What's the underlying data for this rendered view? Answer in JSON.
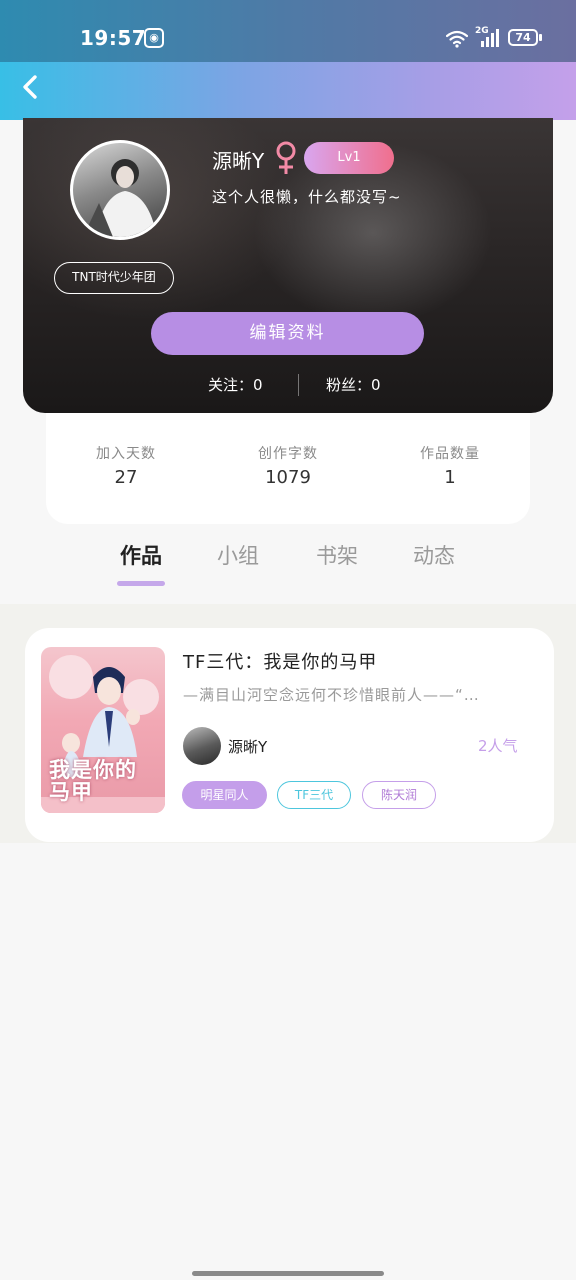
{
  "status_bar": {
    "time": "19:57",
    "network_label": "2G",
    "battery": "74",
    "icons": [
      "app-notification-icon",
      "wifi-icon",
      "signal-icon",
      "battery-icon"
    ]
  },
  "header": {
    "back_icon": "chevron-left-icon"
  },
  "profile": {
    "nickname": "源晰Y",
    "gender_icon": "female-icon",
    "level": "Lv1",
    "bio": "这个人很懒，什么都没写~",
    "group_tag": "TNT时代少年团",
    "edit_button": "编辑资料",
    "follow": "关注：0",
    "fans": "粉丝：0"
  },
  "stats": [
    {
      "label": "加入天数",
      "value": "27"
    },
    {
      "label": "创作字数",
      "value": "1079"
    },
    {
      "label": "作品数量",
      "value": "1"
    }
  ],
  "tabs": [
    {
      "label": "作品",
      "active": true
    },
    {
      "label": "小组",
      "active": false
    },
    {
      "label": "书架",
      "active": false
    },
    {
      "label": "动态",
      "active": false
    }
  ],
  "works": [
    {
      "title": "TF三代：我是你的马甲",
      "intro": "—满目山河空念远何不珍惜眼前人——“…",
      "cover_text": "我是你的马甲",
      "author": "源晰Y",
      "popularity": "2人气",
      "tags": [
        "明星同人",
        "TF三代",
        "陈天润"
      ]
    }
  ],
  "colors": {
    "accent_purple": "#b78ee4",
    "header_gradient_start": "#38bfe6",
    "header_gradient_end": "#c4a0ea",
    "tag_cyan": "#4dc6dd",
    "level_gradient_end": "#f06f8d"
  }
}
